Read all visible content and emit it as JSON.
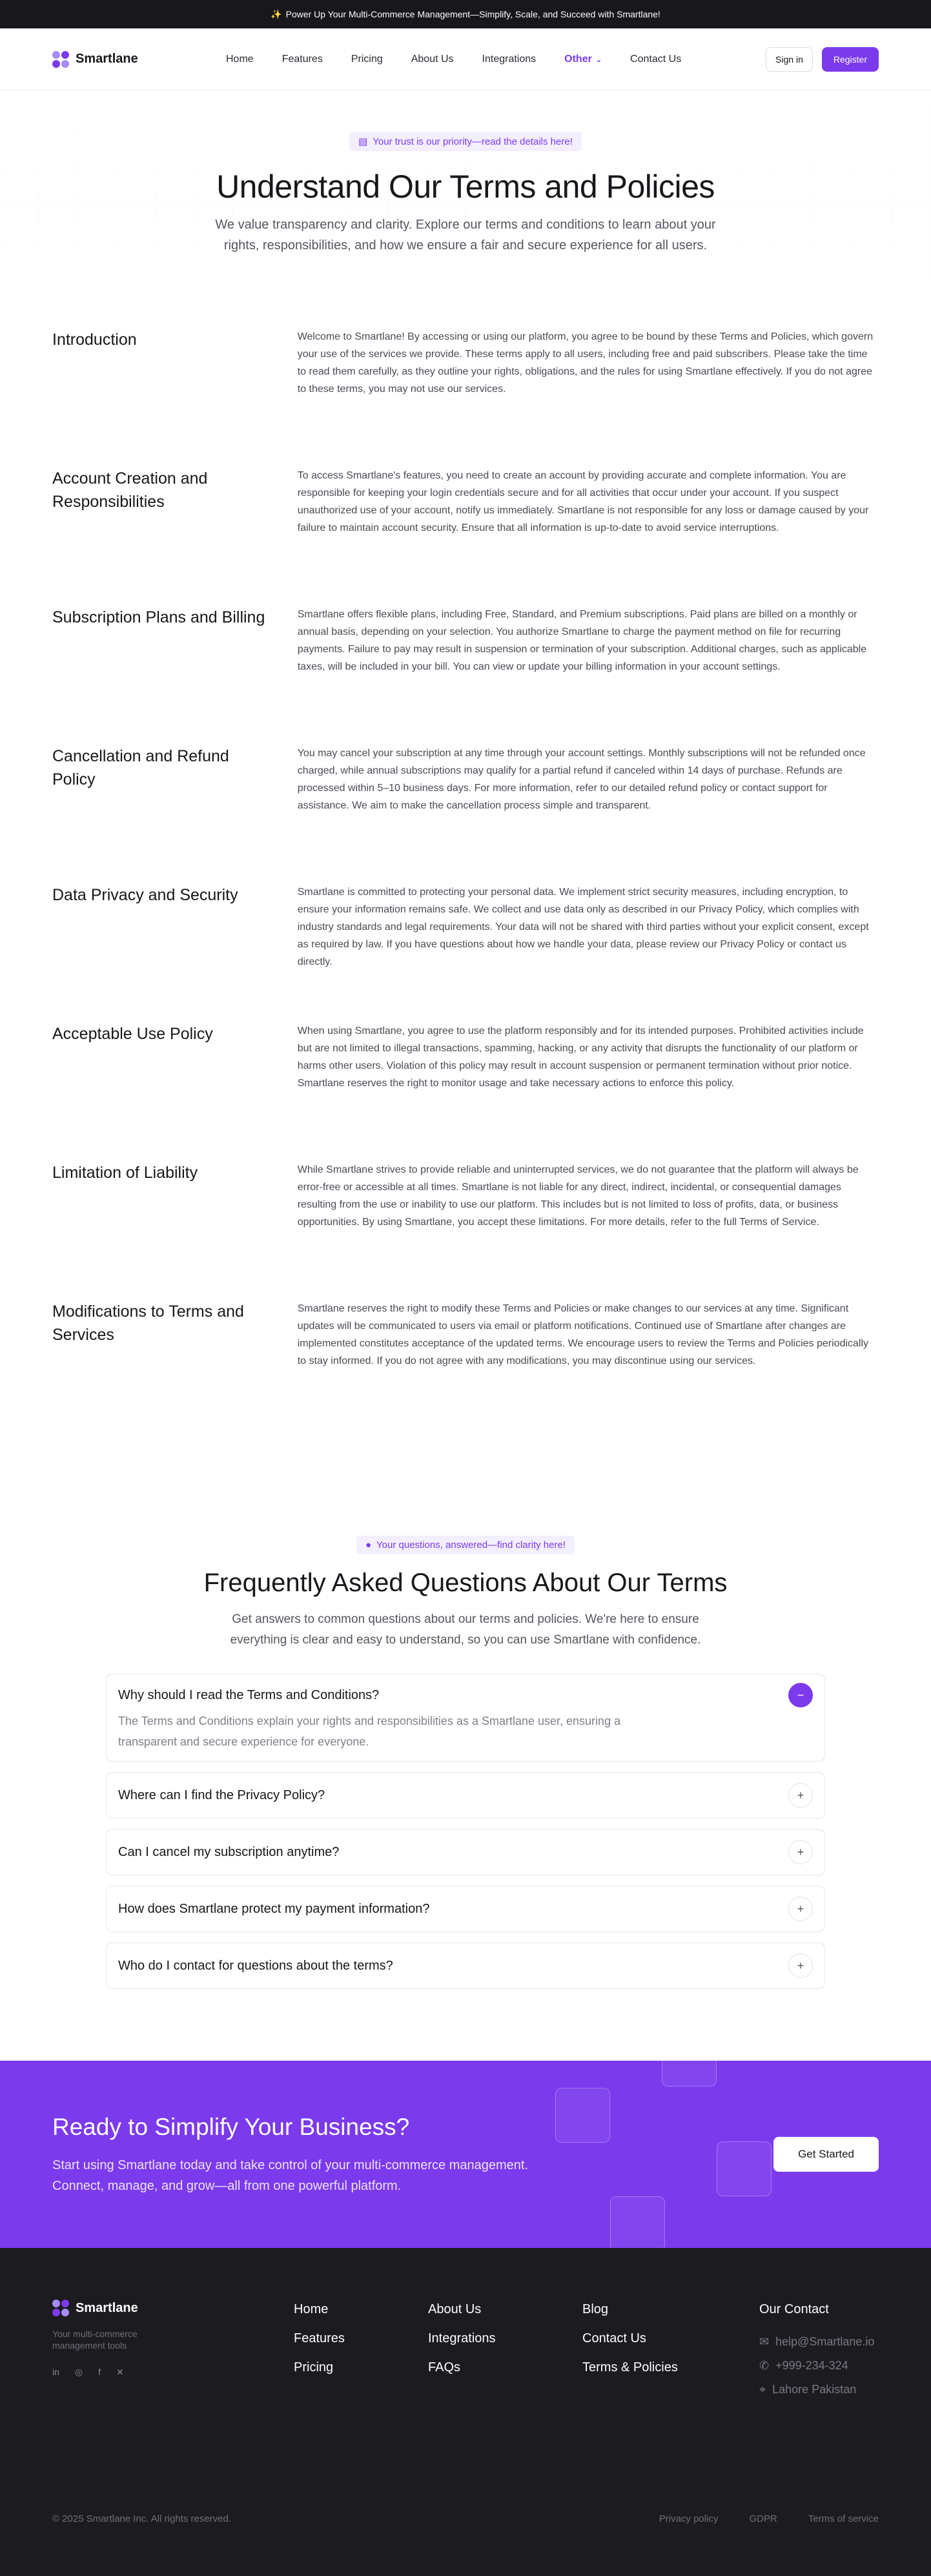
{
  "announcement": {
    "text": "Power Up Your Multi-Commerce Management—Simplify, Scale, and Succeed with Smartlane!"
  },
  "brand": {
    "name": "Smartlane",
    "accent": "#7c3aed"
  },
  "nav": {
    "links": [
      "Home",
      "Features",
      "Pricing",
      "About Us",
      "Integrations",
      "Other",
      "Contact Us"
    ],
    "active": "Other",
    "sign_in": "Sign in",
    "register": "Register"
  },
  "hero": {
    "badge": "Your trust is our priority—read the details here!",
    "title": "Understand Our Terms and Policies",
    "subtitle": "We value transparency and clarity. Explore our terms and conditions to learn about your rights, responsibilities, and how we ensure a fair and secure experience for all users."
  },
  "terms": [
    {
      "title": "Introduction",
      "body": "Welcome to Smartlane! By accessing or using our platform, you agree to be bound by these Terms and Policies, which govern your use of the services we provide. These terms apply to all users, including free and paid subscribers. Please take the time to read them carefully, as they outline your rights, obligations, and the rules for using Smartlane effectively. If you do not agree to these terms, you may not use our services."
    },
    {
      "title": "Account Creation and Responsibilities",
      "body": "To access Smartlane's features, you need to create an account by providing accurate and complete information. You are responsible for keeping your login credentials secure and for all activities that occur under your account. If you suspect unauthorized use of your account, notify us immediately. Smartlane is not responsible for any loss or damage caused by your failure to maintain account security. Ensure that all information is up-to-date to avoid service interruptions."
    },
    {
      "title": "Subscription Plans and Billing",
      "body": "Smartlane offers flexible plans, including Free, Standard, and Premium subscriptions. Paid plans are billed on a monthly or annual basis, depending on your selection. You authorize Smartlane to charge the payment method on file for recurring payments. Failure to pay may result in suspension or termination of your subscription. Additional charges, such as applicable taxes, will be included in your bill. You can view or update your billing information in your account settings."
    },
    {
      "title": "Cancellation and Refund Policy",
      "body": "You may cancel your subscription at any time through your account settings. Monthly subscriptions will not be refunded once charged, while annual subscriptions may qualify for a partial refund if canceled within 14 days of purchase. Refunds are processed within 5–10 business days. For more information, refer to our detailed refund policy or contact support for assistance. We aim to make the cancellation process simple and transparent."
    },
    {
      "title": "Data Privacy and Security",
      "body": "Smartlane is committed to protecting your personal data. We implement strict security measures, including encryption, to ensure your information remains safe. We collect and use data only as described in our Privacy Policy, which complies with industry standards and legal requirements. Your data will not be shared with third parties without your explicit consent, except as required by law. If you have questions about how we handle your data, please review our Privacy Policy or contact us directly."
    },
    {
      "title": "Acceptable Use Policy",
      "body": "When using Smartlane, you agree to use the platform responsibly and for its intended purposes. Prohibited activities include but are not limited to illegal transactions, spamming, hacking, or any activity that disrupts the functionality of our platform or harms other users. Violation of this policy may result in account suspension or permanent termination without prior notice. Smartlane reserves the right to monitor usage and take necessary actions to enforce this policy."
    },
    {
      "title": "Limitation of Liability",
      "body": "While Smartlane strives to provide reliable and uninterrupted services, we do not guarantee that the platform will always be error-free or accessible at all times. Smartlane is not liable for any direct, indirect, incidental, or consequential damages resulting from the use or inability to use our platform. This includes but is not limited to loss of profits, data, or business opportunities. By using Smartlane, you accept these limitations. For more details, refer to the full Terms of Service."
    },
    {
      "title": "Modifications to Terms and Services",
      "body": "Smartlane reserves the right to modify these Terms and Policies or make changes to our services at any time. Significant updates will be communicated to users via email or platform notifications. Continued use of Smartlane after changes are implemented constitutes acceptance of the updated terms. We encourage users to review the Terms and Policies periodically to stay informed. If you do not agree with any modifications, you may discontinue using our services."
    }
  ],
  "faq": {
    "badge": "Your questions, answered—find clarity here!",
    "title": "Frequently Asked Questions About Our Terms",
    "subtitle": "Get answers to common questions about our terms and policies. We're here to ensure everything is clear and easy to understand, so you can use Smartlane with confidence.",
    "items": [
      {
        "q": "Why should I read the Terms and Conditions?",
        "a": "The Terms and Conditions explain your rights and responsibilities as a Smartlane user, ensuring a transparent and secure experience for everyone."
      },
      {
        "q": "Where can I find the Privacy Policy?"
      },
      {
        "q": "Can I cancel my subscription anytime?"
      },
      {
        "q": "How does Smartlane protect my payment information?"
      },
      {
        "q": "Who do I contact for questions about the terms?"
      }
    ]
  },
  "cta": {
    "title": "Ready to Simplify Your Business?",
    "text": "Start using Smartlane today and take control of your multi-commerce management. Connect, manage, and grow—all from one powerful platform.",
    "button": "Get Started"
  },
  "footer": {
    "tagline": "Your multi-commerce management tools",
    "social": [
      "linkedin-icon",
      "instagram-icon",
      "facebook-icon",
      "x-icon"
    ],
    "col1": [
      "Home",
      "Features",
      "Pricing"
    ],
    "col2": [
      "About Us",
      "Integrations",
      "FAQs"
    ],
    "col3": [
      "Blog",
      "Contact Us",
      "Terms & Policies"
    ],
    "contact": {
      "title": "Our Contact",
      "email": "help@Smartlane.io",
      "phone": "+999-234-324",
      "address": "Lahore Pakistan"
    },
    "copyright": "© 2025 Smartlane Inc. All rights reserved.",
    "bottom_links": [
      "Privacy policy",
      "GDPR",
      "Terms of service"
    ]
  }
}
